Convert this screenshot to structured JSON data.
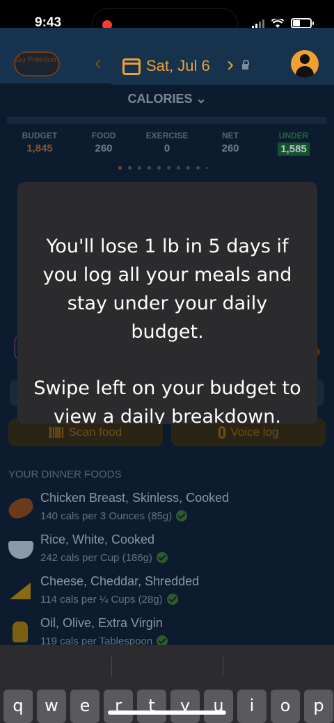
{
  "status": {
    "time": "9:43"
  },
  "header": {
    "premium_label": "Go Premium",
    "prev_arrow": "‹",
    "date": "Sat, Jul 6",
    "next_arrow": "›",
    "calendar_icon": "calendar-icon",
    "lock_icon": "lock-icon",
    "avatar_icon": "user-avatar-icon"
  },
  "calories": {
    "title": "CALORIES ⌄",
    "stats": [
      {
        "label": "BUDGET",
        "value": "1,845"
      },
      {
        "label": "FOOD",
        "value": "260"
      },
      {
        "label": "EXERCISE",
        "value": "0"
      },
      {
        "label": "NET",
        "value": "260"
      },
      {
        "label": "UNDER",
        "value": "1,585"
      }
    ],
    "page_dots": 10,
    "active_dot": 0
  },
  "actions": {
    "scan_label": "Scan food",
    "voice_label": "Voice log"
  },
  "foods": {
    "header": "YOUR DINNER FOODS",
    "items": [
      {
        "name": "Chicken Breast, Skinless, Cooked",
        "cals": "140 cals per 3 Ounces (85g)",
        "icon": "chicken-icon"
      },
      {
        "name": "Rice, White, Cooked",
        "cals": "242 cals per Cup (186g)",
        "icon": "rice-bowl-icon"
      },
      {
        "name": "Cheese, Cheddar, Shredded",
        "cals": "114 cals per ¼ Cups (28g)",
        "icon": "cheese-icon"
      },
      {
        "name": "Oil, Olive, Extra Virgin",
        "cals": "119 cals per Tablespoon",
        "icon": "oil-bottle-icon"
      }
    ]
  },
  "tip": {
    "line1": "You'll lose 1 lb in 5 days if you log all your meals and stay under your daily budget.",
    "line2": "Swipe left on your budget to view a daily breakdown."
  },
  "keyboard": {
    "keys": [
      "q",
      "w",
      "e",
      "r",
      "t",
      "y",
      "u",
      "i",
      "o",
      "p"
    ]
  },
  "colors": {
    "accent": "#e8a33a",
    "under_green": "#14522b",
    "overlay_card": "#2b2b2d",
    "recording_dot": "#ff3b30"
  }
}
